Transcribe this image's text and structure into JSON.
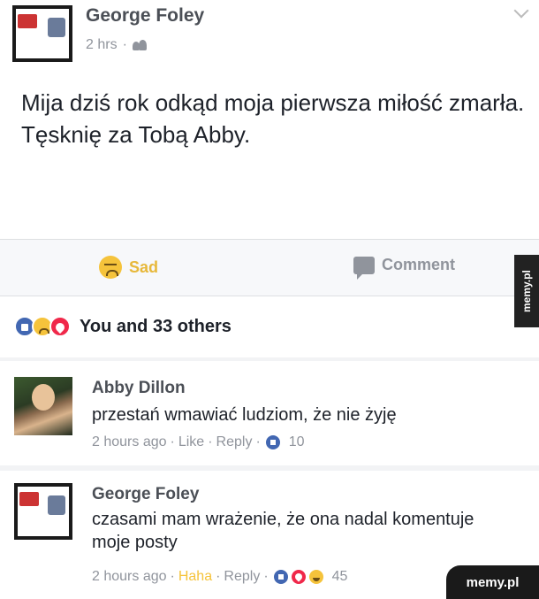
{
  "post": {
    "author": "George Foley",
    "time": "2 hrs",
    "separator": "·",
    "text": "Mija dziś rok odkąd moja pierwsza miłość zmarła. Tęsknię za Tobą Abby."
  },
  "actions": {
    "reaction_label": "Sad",
    "comment_label": "Comment",
    "reaction_icon": "sad-face-icon",
    "comment_icon": "comment-icon"
  },
  "reactions": {
    "icons": [
      "like-icon",
      "sad-icon",
      "love-icon"
    ],
    "summary": "You and 33 others"
  },
  "comments": [
    {
      "author": "Abby Dillon",
      "text": "przestań wmawiać ludziom, że nie żyję",
      "time": "2 hours ago",
      "reaction_label": "Like",
      "reply_label": "Reply",
      "reaction_count": "10",
      "reaction_icons": [
        "like-icon"
      ]
    },
    {
      "author": "George Foley",
      "text": "czasami mam wrażenie, że ona nadal komentuje moje posty",
      "time": "2 hours ago",
      "reaction_label": "Haha",
      "reply_label": "Reply",
      "reaction_count": "45",
      "reaction_icons": [
        "like-icon",
        "love-icon",
        "haha-icon"
      ]
    }
  ],
  "watermark": {
    "side": "memy.pl",
    "bottom": "memy.pl"
  },
  "colors": {
    "like_blue": "#4267b2",
    "love_red": "#f0284a",
    "sad_yellow": "#e7b83a",
    "meta_gray": "#90949c"
  }
}
